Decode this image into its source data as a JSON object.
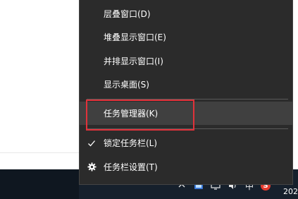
{
  "context_menu": {
    "items": [
      {
        "label": "层叠窗口(D)"
      },
      {
        "label": "堆叠显示窗口(E)"
      },
      {
        "label": "并排显示窗口(I)"
      },
      {
        "label": "显示桌面(S)"
      },
      {
        "label": "任务管理器(K)",
        "state": "hovered",
        "highlighted": true
      },
      {
        "label": "锁定任务栏(L)",
        "checked": true,
        "icon": "check-icon"
      },
      {
        "label": "任务栏设置(T)",
        "icon": "gear-icon"
      }
    ]
  },
  "taskbar": {
    "tray_icons": [
      "chevron-up-icon",
      "app-icon",
      "network-icon",
      "speaker-icon",
      "input-method-icon",
      "sogou-icon"
    ],
    "ime_label": "中",
    "sogou_label": "S",
    "clock": "202"
  },
  "colors": {
    "menu_bg": "#2b2b2b",
    "menu_hover": "#404040",
    "highlight": "#e0323a",
    "taskbar": "#16202c"
  }
}
